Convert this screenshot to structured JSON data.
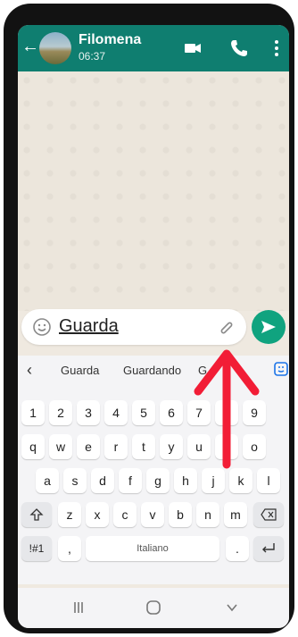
{
  "header": {
    "contact_name": "Filomena",
    "time": "06:37"
  },
  "composer": {
    "text": "Guarda"
  },
  "suggestions": [
    "Guarda",
    "Guardando",
    "G"
  ],
  "keyboard": {
    "row1": [
      "1",
      "2",
      "3",
      "4",
      "5",
      "6",
      "7",
      "8",
      "9"
    ],
    "row2": [
      "q",
      "w",
      "e",
      "r",
      "t",
      "y",
      "u",
      "i",
      "o"
    ],
    "row3": [
      "a",
      "s",
      "d",
      "f",
      "g",
      "h",
      "j",
      "k",
      "l"
    ],
    "row4": [
      "z",
      "x",
      "c",
      "v",
      "b",
      "n",
      "m"
    ],
    "symbols_label": "!#1",
    "comma": ",",
    "space_label": "Italiano",
    "period": "."
  },
  "colors": {
    "accent": "#0f7e70",
    "send": "#10a37f",
    "arrow": "#f21d36"
  },
  "icons": [
    "back-arrow-icon",
    "video-call-icon",
    "phone-icon",
    "more-icon",
    "emoji-icon",
    "attach-icon",
    "send-icon",
    "sticker-icon",
    "shift-icon",
    "backspace-icon",
    "enter-icon"
  ]
}
